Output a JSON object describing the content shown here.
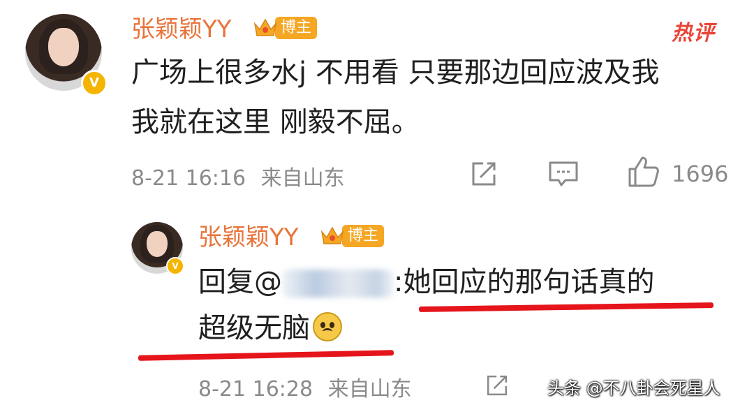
{
  "comment": {
    "username": "张颖颖YY",
    "badge_label": "博主",
    "hot_label": "热评",
    "text_line1": "广场上很多水j 不用看 只要那边回应波及我",
    "text_line2": "我就在这里 刚毅不屈。",
    "timestamp": "8-21 16:16",
    "location": "来自山东",
    "like_count": "1696",
    "verified_mark": "V"
  },
  "reply": {
    "username": "张颖颖YY",
    "badge_label": "博主",
    "prefix": "回复@",
    "suffix": ":她回应的那句话真的",
    "line2": "超级无脑",
    "timestamp": "8-21 16:28",
    "location": "来自山东",
    "verified_mark": "V"
  },
  "watermark": "头条 @不八卦会死星人",
  "colors": {
    "username": "#e8743b",
    "badge": "#f5a623",
    "hot": "#e9463a",
    "underline": "#e5151b",
    "meta": "#8a8a8a"
  },
  "icons": [
    "share-icon",
    "comment-icon",
    "like-icon",
    "crown-icon",
    "verified-icon",
    "sad-emoji-icon"
  ]
}
